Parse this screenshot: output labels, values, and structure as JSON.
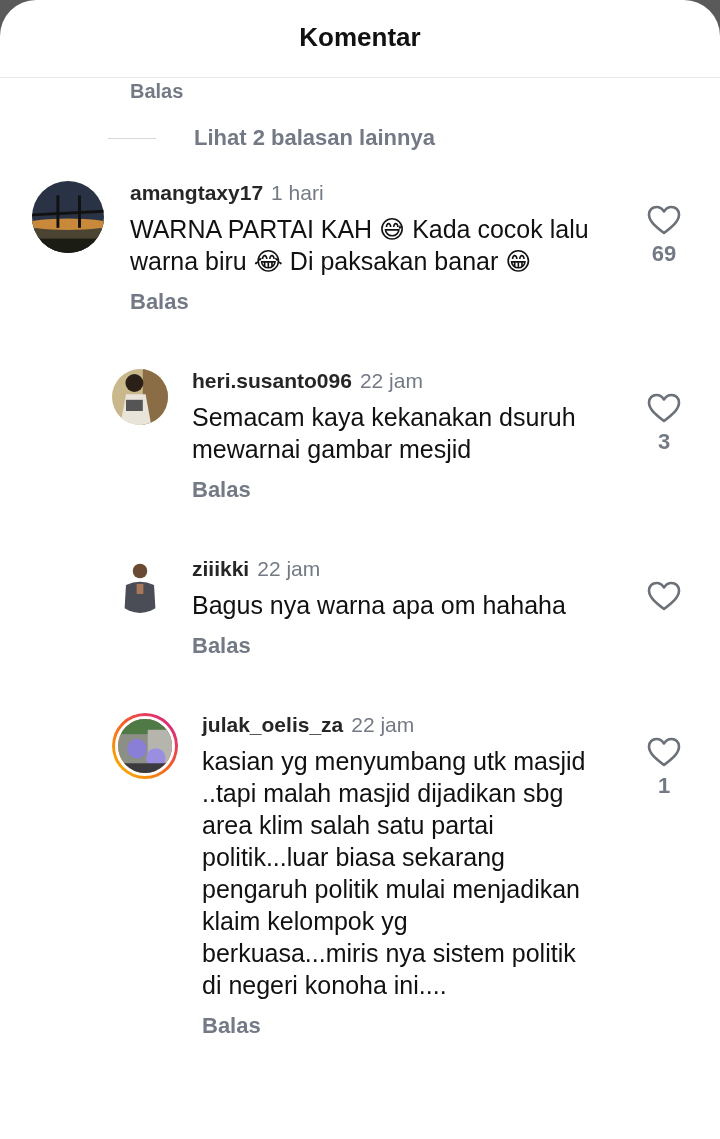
{
  "header": {
    "title": "Komentar"
  },
  "previous_reply_link": "Balas",
  "more_replies": "Lihat 2 balasan lainnya",
  "comments": [
    {
      "kind": "comment",
      "username": "amangtaxy17",
      "time": "1 hari",
      "text": "WARNA PARTAI KAH 😅 Kada cocok lalu warna biru 😂 Di paksakan banar 😁",
      "reply": "Balas",
      "likes": "69",
      "story_ring": false,
      "liked": false
    },
    {
      "kind": "reply",
      "username": "heri.susanto096",
      "time": "22 jam",
      "text": "Semacam kaya kekanakan dsuruh mewarnai gambar mesjid",
      "reply": "Balas",
      "likes": "3",
      "story_ring": false,
      "liked": false
    },
    {
      "kind": "reply",
      "username": "ziiikki",
      "time": "22 jam",
      "text": "Bagus nya warna apa om hahaha",
      "reply": "Balas",
      "story_ring": false,
      "liked": false
    },
    {
      "kind": "reply",
      "username": "julak_oelis_za",
      "time": "22 jam",
      "text": "kasian yg menyumbang utk masjid ..tapi malah masjid dijadikan sbg area klim salah satu partai politik...luar biasa sekarang pengaruh politik mulai menjadikan klaim kelompok yg berkuasa...miris nya sistem politik di negeri konoha ini....",
      "reply": "Balas",
      "likes": "1",
      "story_ring": true,
      "liked": false
    }
  ]
}
